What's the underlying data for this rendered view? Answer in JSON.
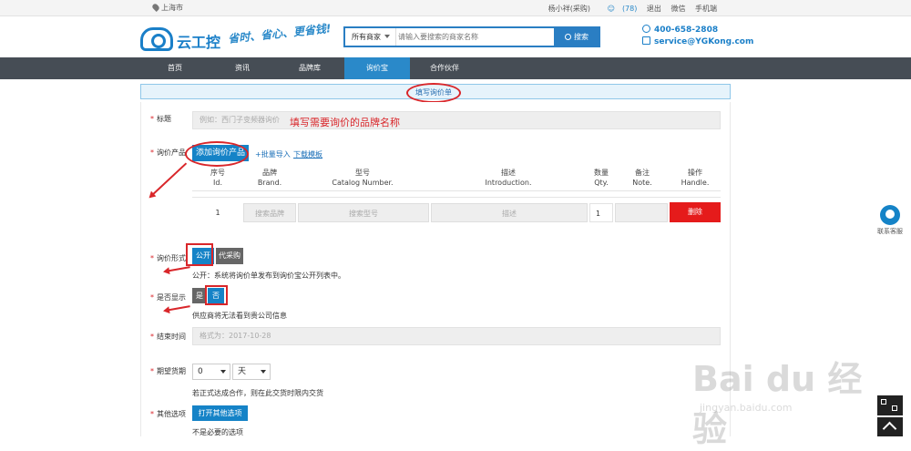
{
  "topbar": {
    "location": "上海市",
    "user": "杨小祥(采购)",
    "message_count": "(78)",
    "logout": "退出",
    "wechat": "微信",
    "mobile": "手机端"
  },
  "header": {
    "logo_text": "云工控",
    "slogan": "省时、省心、更省钱!",
    "search_scope": "所有商家",
    "search_placeholder": "请输入要搜索的商家名称",
    "search_button": "搜索",
    "phone": "400-658-2808",
    "email": "service@YGKong.com"
  },
  "nav": [
    {
      "label": "首页",
      "active": false
    },
    {
      "label": "资讯",
      "active": false
    },
    {
      "label": "品牌库",
      "active": false
    },
    {
      "label": "询价宝",
      "active": true
    },
    {
      "label": "合作伙伴",
      "active": false
    }
  ],
  "tab": {
    "label": "填写询价单"
  },
  "form": {
    "title": {
      "label": "标题",
      "placeholder": "例如：西门子变频器询价",
      "hint": "填写需要询价的品牌名称"
    },
    "products": {
      "label": "询价产品",
      "add_button": "添加询价产品",
      "bulk_import": "+批量导入",
      "download_template": "下载模板",
      "headers": [
        {
          "cn": "序号",
          "en": "Id."
        },
        {
          "cn": "品牌",
          "en": "Brand."
        },
        {
          "cn": "型号",
          "en": "Catalog Number."
        },
        {
          "cn": "描述",
          "en": "Introduction."
        },
        {
          "cn": "数量",
          "en": "Qty."
        },
        {
          "cn": "备注",
          "en": "Note."
        },
        {
          "cn": "操作",
          "en": "Handle."
        }
      ],
      "row": {
        "id": "1",
        "brand_placeholder": "搜索品牌",
        "model_placeholder": "搜索型号",
        "desc_placeholder": "描述",
        "qty": "1",
        "note": "",
        "delete": "删除"
      }
    },
    "form_type": {
      "label": "询价形式",
      "options": [
        "公开",
        "代采购"
      ],
      "selected": "公开",
      "note": "公开：系统将询价单发布到询价宝公开列表中。"
    },
    "display": {
      "label": "是否显示",
      "options": [
        "是",
        "否"
      ],
      "selected": "否",
      "note": "供应商将无法看到贵公司信息"
    },
    "end_time": {
      "label": "结束时间",
      "placeholder": "格式为：2017-10-28"
    },
    "delivery": {
      "label": "期望货期",
      "value": "0",
      "unit": "天",
      "note": "若正式达成合作，则在此交货时限内交货"
    },
    "other": {
      "label": "其他选项",
      "button": "打开其他选项",
      "note": "不是必要的选项"
    }
  },
  "side": {
    "customer_service": "联系客服"
  },
  "watermark": {
    "main": "Bai du 经验",
    "sub": "jingyan.baidu.com"
  },
  "colors": {
    "primary": "#1583c7",
    "nav_bg": "#464d55",
    "highlight": "#d9262a",
    "delete": "#e51b1b"
  }
}
